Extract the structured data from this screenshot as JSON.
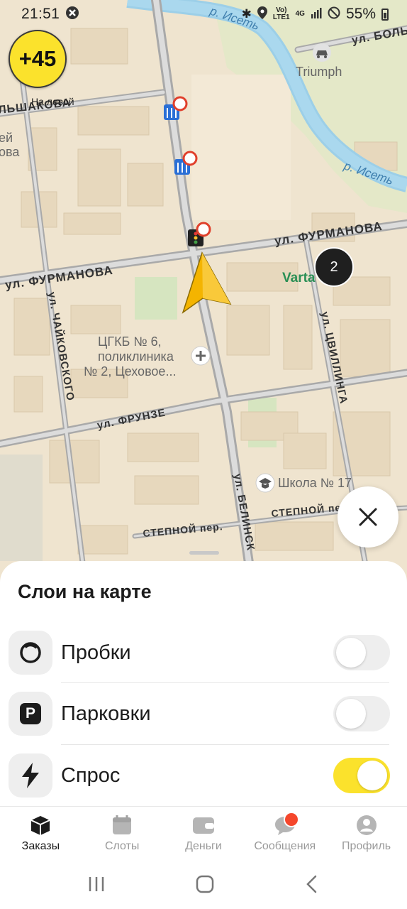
{
  "status_bar": {
    "time": "21:51",
    "network_top": "Vo)",
    "network_bottom": "LTE1",
    "network_type": "4G",
    "battery": "55%"
  },
  "map": {
    "rating": "+45",
    "cluster_count": "2",
    "streets": {
      "furmanova_left": "ул. ФУРМАНОВА",
      "furmanova_right": "ул. ФУРМАНОВА",
      "chaikovskogo": "ул. ЧАЙКОВСКОГО",
      "frunze": "ул. ФРУНЗЕ",
      "tsvillinga": "ул. ЦВИЛЛИНГА",
      "belinskogo": "ул. БЕЛИНСК",
      "stepnoi_left": "СТЕПНОЙ пер.",
      "stepnoi_right": "СТЕПНОЙ пе",
      "bolshakova": "ЛЬШАКОВА",
      "bolsh_right": "ул. БОЛЬ",
      "river_top": "р. Исеть",
      "river_right": "р. Исеть"
    },
    "pois": {
      "triumph": "Triumph",
      "vartan": "Varta",
      "hospital_1": "ЦГКБ № 6,",
      "hospital_2": "поликлиника",
      "hospital_3": "№ 2, Цеховое...",
      "school": "Школа № 17",
      "on_left": "На левой",
      "fragment_1": "ей",
      "fragment_2": "ова"
    }
  },
  "layers_sheet": {
    "title": "Слои на карте",
    "items": [
      {
        "label": "Пробки",
        "icon": "traffic-icon",
        "enabled": false
      },
      {
        "label": "Парковки",
        "icon": "parking-icon",
        "icon_letter": "P",
        "enabled": false
      },
      {
        "label": "Спрос",
        "icon": "lightning-icon",
        "enabled": true
      }
    ]
  },
  "tabs": [
    {
      "label": "Заказы",
      "icon": "orders-icon",
      "active": true
    },
    {
      "label": "Слоты",
      "icon": "calendar-icon",
      "active": false
    },
    {
      "label": "Деньги",
      "icon": "wallet-icon",
      "active": false
    },
    {
      "label": "Сообщения",
      "icon": "chat-icon",
      "active": false,
      "badge": true
    },
    {
      "label": "Профиль",
      "icon": "profile-icon",
      "active": false
    }
  ],
  "colors": {
    "accent": "#fbe22c",
    "map_bg": "#efe4cf",
    "river": "#9ccfe8",
    "notification": "#f5472c"
  }
}
